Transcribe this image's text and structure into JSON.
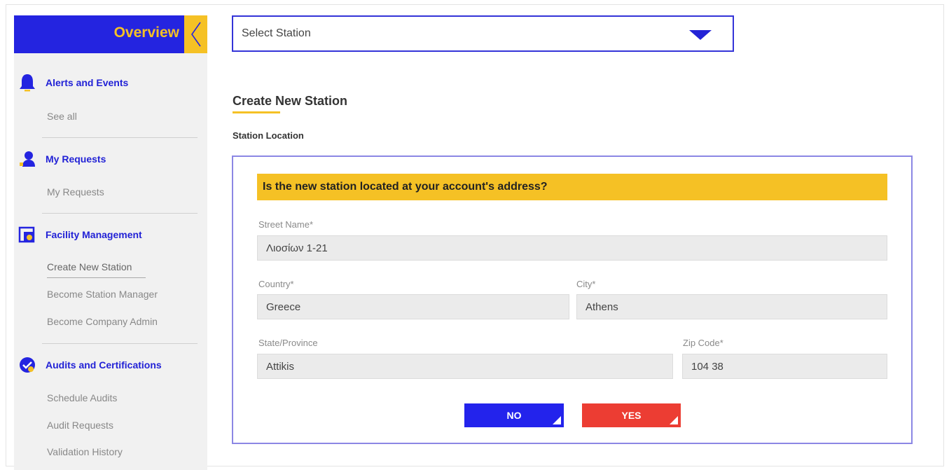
{
  "sidebar": {
    "overview": "Overview",
    "sections": [
      {
        "title": "Alerts and Events",
        "items": [
          "See all"
        ]
      },
      {
        "title": "My Requests",
        "items": [
          "My Requests"
        ]
      },
      {
        "title": "Facility Management",
        "items": [
          "Create New Station",
          "Become Station Manager",
          "Become Company Admin"
        ]
      },
      {
        "title": "Audits and Certifications",
        "items": [
          "Schedule Audits",
          "Audit Requests",
          "Validation History"
        ]
      }
    ],
    "active_item": "Create New Station"
  },
  "station_select": {
    "value": "Select Station"
  },
  "page": {
    "title": "Create New Station",
    "section_label": "Station Location",
    "question": "Is the new station located at your account's address?"
  },
  "form": {
    "street": {
      "label": "Street Name*",
      "value": "Λιοσίων 1-21"
    },
    "country": {
      "label": "Country*",
      "value": "Greece"
    },
    "city": {
      "label": "City*",
      "value": "Athens"
    },
    "state": {
      "label": "State/Province",
      "value": "Attikis"
    },
    "zip": {
      "label": "Zip Code*",
      "value": "104 38"
    }
  },
  "buttons": {
    "no": "NO",
    "yes": "YES"
  },
  "colors": {
    "primary": "#2424e0",
    "accent": "#f5c125",
    "danger": "#ec3d33"
  }
}
